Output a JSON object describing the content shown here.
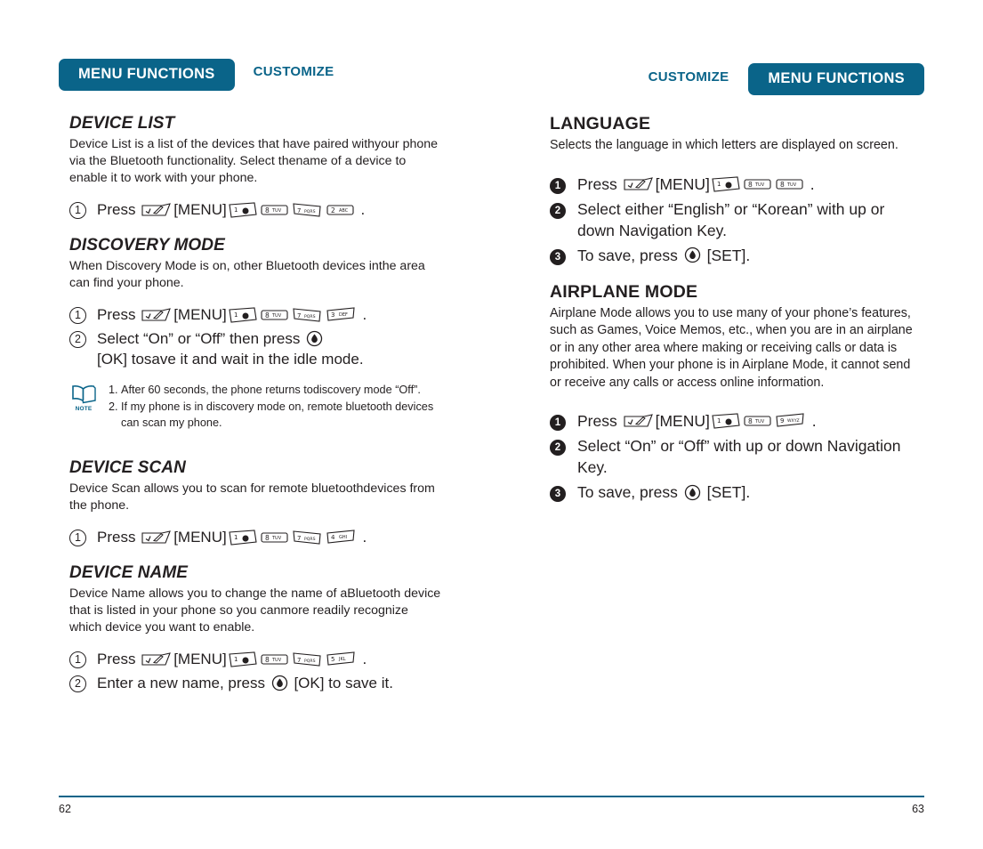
{
  "header": {
    "left": {
      "badge": "MENU FUNCTIONS",
      "tag": "CUSTOMIZE"
    },
    "right": {
      "badge": "MENU FUNCTIONS",
      "tag": "CUSTOMIZE"
    }
  },
  "colors": {
    "accent": "#0a6489",
    "text": "#231f20",
    "badge_text": "#ffffff"
  },
  "left_column": {
    "sections": [
      {
        "title": "DEVICE LIST",
        "body": "Device List is a list of the devices that have paired withyour phone via the Bluetooth functionality. Select thename of a device to enable it to work with your phone.",
        "steps": [
          {
            "num": "1",
            "pre": "Press",
            "menu_label": "[MENU]",
            "keys": [
              "menu",
              "1",
              "8",
              "7",
              "2"
            ],
            "post": "."
          }
        ]
      },
      {
        "title": "DISCOVERY MODE",
        "body": "When Discovery Mode is on, other Bluetooth devices inthe area can find your phone.",
        "steps": [
          {
            "num": "1",
            "pre": "Press",
            "menu_label": "[MENU]",
            "keys": [
              "menu",
              "1",
              "8",
              "7",
              "3"
            ],
            "post": "."
          },
          {
            "num": "2",
            "pre": "Select “On” or “Off” then press",
            "ok_icon": "ok-key-icon",
            "post": "[OK] tosave it and wait in the idle mode."
          }
        ]
      }
    ],
    "note": {
      "icon": "note-book-icon",
      "icon_label": "NOTE",
      "items": [
        {
          "num": "1.",
          "text": "After 60 seconds, the phone returns todiscovery mode “Off”."
        },
        {
          "num": "2.",
          "text": "If my phone is in discovery mode on, remote bluetooth devices can scan my phone."
        }
      ]
    },
    "sections2": [
      {
        "title": "DEVICE SCAN",
        "body": "Device Scan allows you to scan for remote bluetoothdevices from the phone.",
        "steps": [
          {
            "num": "1",
            "pre": "Press",
            "menu_label": "[MENU]",
            "keys": [
              "menu",
              "1",
              "8",
              "7",
              "4"
            ],
            "post": "."
          }
        ]
      },
      {
        "title": "DEVICE NAME",
        "body": "Device Name allows you to change the name of aBluetooth device that is listed in your phone so you canmore readily recognize which device you want to enable.",
        "steps": [
          {
            "num": "1",
            "pre": "Press",
            "menu_label": "[MENU]",
            "keys": [
              "menu",
              "1",
              "8",
              "7",
              "5"
            ],
            "post": "."
          },
          {
            "num": "2",
            "pre": "Enter a new name, press",
            "ok_icon": "ok-key-icon",
            "post": "[OK] to save it."
          }
        ]
      }
    ]
  },
  "right_column": {
    "sections": [
      {
        "title": "LANGUAGE",
        "body": "Selects the language in which letters are displayed on screen.",
        "steps": [
          {
            "num": "1",
            "pre": "Press",
            "menu_label": "[MENU]",
            "keys": [
              "menu",
              "1",
              "8",
              "8"
            ],
            "post": "."
          },
          {
            "num": "2",
            "pre": "Select either “English” or “Korean” with up or down Navigation Key."
          },
          {
            "num": "3",
            "pre": "To save, press",
            "ok_icon": "ok-key-icon",
            "post": "[SET]."
          }
        ]
      },
      {
        "title": "AIRPLANE MODE",
        "body": "Airplane Mode allows you to use many of your phone’s features, such as Games, Voice Memos, etc., when you are in an airplane or in any other area where making or receiving calls or data is prohibited. When your phone is in Airplane Mode, it cannot send or receive any calls or access online information.",
        "steps": [
          {
            "num": "1",
            "pre": "Press",
            "menu_label": "[MENU]",
            "keys": [
              "menu",
              "1",
              "8",
              "9"
            ],
            "post": "."
          },
          {
            "num": "2",
            "pre": "Select “On” or “Off” with up or down Navigation Key."
          },
          {
            "num": "3",
            "pre": "To save, press",
            "ok_icon": "ok-key-icon",
            "post": "[SET]."
          }
        ]
      }
    ]
  },
  "footer": {
    "left_page": "62",
    "right_page": "63"
  },
  "key_glyphs": {
    "menu": {
      "label": "",
      "type": "menu-key-icon"
    },
    "1": {
      "label": "1",
      "sub": "☀",
      "type": "digit-key-icon"
    },
    "2": {
      "label": "2",
      "sub": "ABC",
      "type": "digit-key-icon"
    },
    "3": {
      "label": "3",
      "sub": "DEF",
      "type": "digit-key-icon"
    },
    "4": {
      "label": "4",
      "sub": "GHI",
      "type": "digit-key-icon"
    },
    "5": {
      "label": "5",
      "sub": "JKL",
      "type": "digit-key-icon"
    },
    "7": {
      "label": "7",
      "sub": "PQRS",
      "type": "digit-key-icon"
    },
    "8": {
      "label": "8",
      "sub": "TUV",
      "type": "digit-key-icon"
    },
    "9": {
      "label": "9",
      "sub": "WXYZ",
      "type": "digit-key-icon"
    }
  }
}
